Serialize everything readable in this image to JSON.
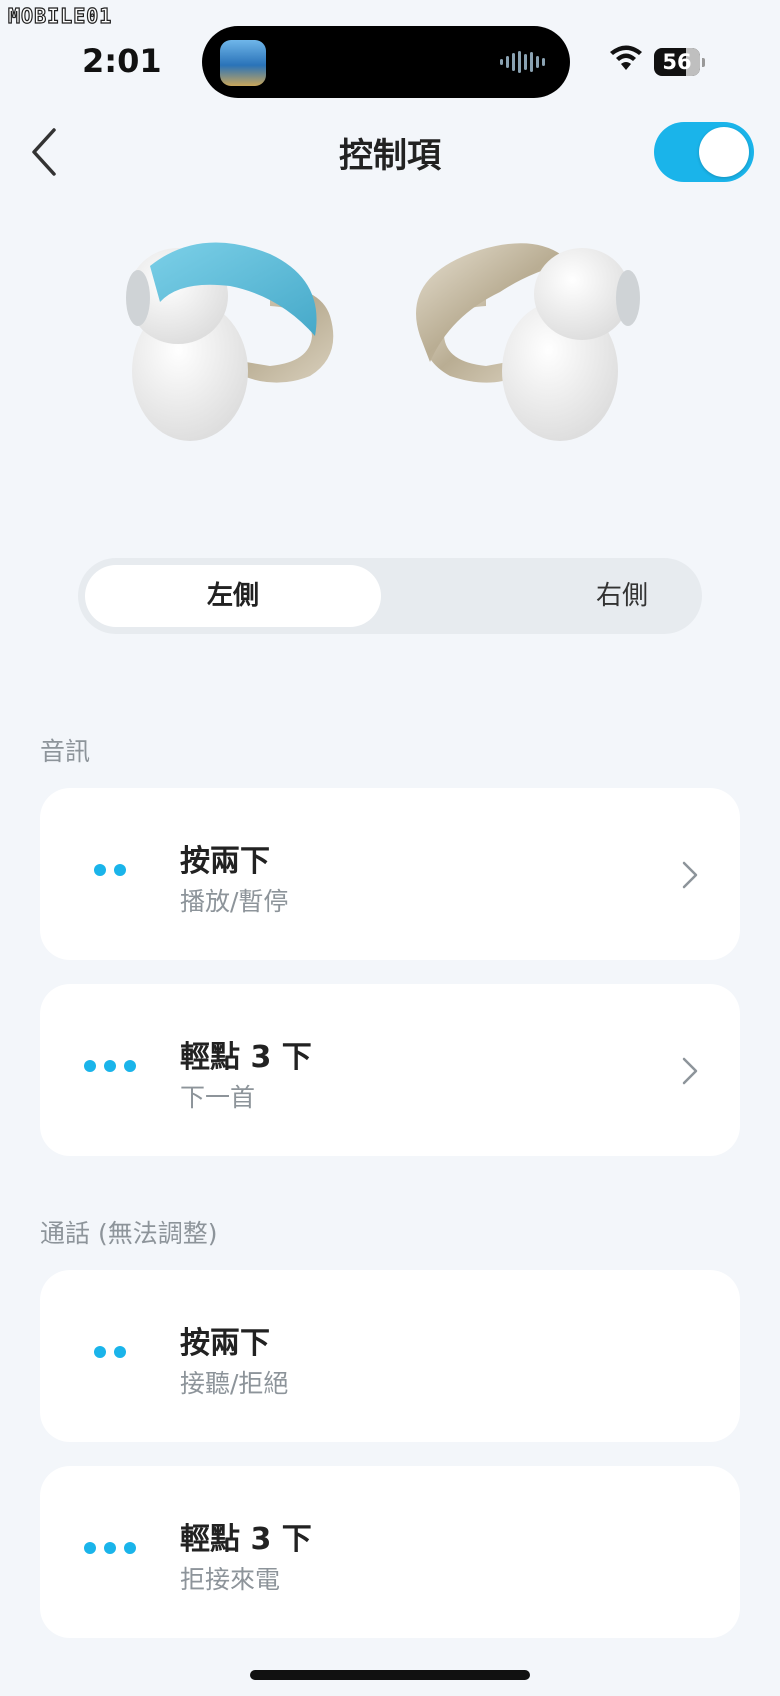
{
  "watermark": "MOBILE01",
  "status_bar": {
    "time": "2:01",
    "battery": "56"
  },
  "nav": {
    "title": "控制項",
    "toggle_on": true
  },
  "colors": {
    "accent": "#1ab4ea",
    "background": "#f3f6fa"
  },
  "segmented": {
    "options": [
      "左側",
      "右側"
    ],
    "selected": "左側"
  },
  "sections": [
    {
      "label": "音訊",
      "items": [
        {
          "title": "按兩下",
          "subtitle": "播放/暫停",
          "dots": 2,
          "chevron": true
        },
        {
          "title": "輕點 3 下",
          "subtitle": "下一首",
          "dots": 3,
          "chevron": true
        }
      ]
    },
    {
      "label": "通話 (無法調整)",
      "items": [
        {
          "title": "按兩下",
          "subtitle": "接聽/拒絕",
          "dots": 2,
          "chevron": false
        },
        {
          "title": "輕點 3 下",
          "subtitle": "拒接來電",
          "dots": 3,
          "chevron": false
        }
      ]
    }
  ]
}
